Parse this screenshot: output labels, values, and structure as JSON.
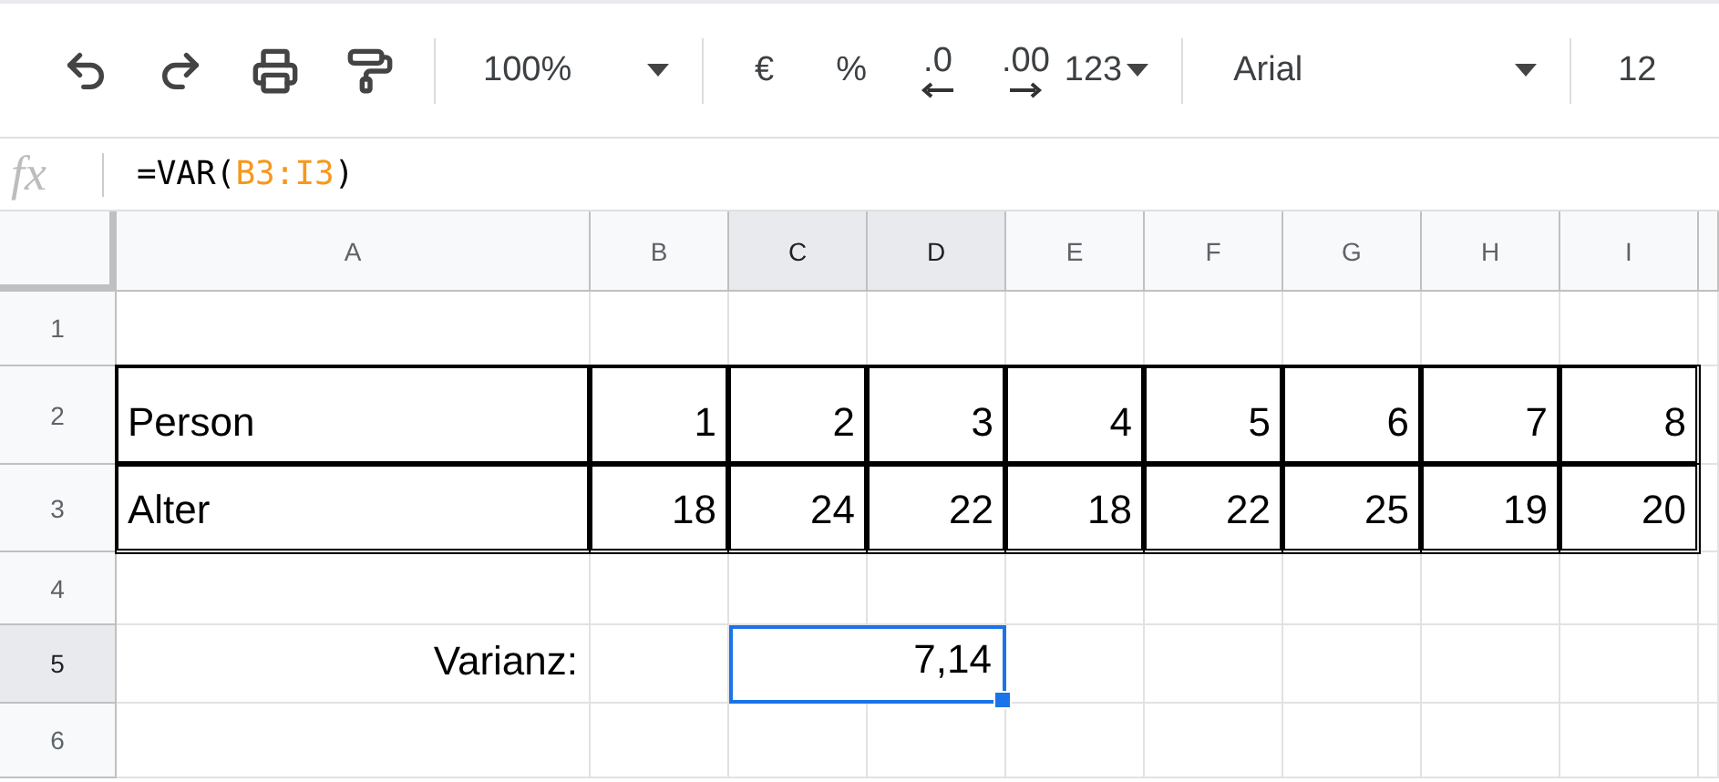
{
  "toolbar": {
    "zoom": "100%",
    "currency": "€",
    "percent": "%",
    "decrease_decimal": ".0",
    "increase_decimal": ".00",
    "more_formats": "123",
    "font": "Arial",
    "font_size": "12"
  },
  "formula_bar": {
    "fx": "fx",
    "formula": [
      {
        "text": "=VAR(",
        "kind": "plain"
      },
      {
        "text": "B3:I3",
        "kind": "reference"
      },
      {
        "text": ")",
        "kind": "plain"
      }
    ]
  },
  "columns": [
    {
      "label": "A",
      "selected": false
    },
    {
      "label": "B",
      "selected": false
    },
    {
      "label": "C",
      "selected": true
    },
    {
      "label": "D",
      "selected": true
    },
    {
      "label": "E",
      "selected": false
    },
    {
      "label": "F",
      "selected": false
    },
    {
      "label": "G",
      "selected": false
    },
    {
      "label": "H",
      "selected": false
    },
    {
      "label": "I",
      "selected": false
    }
  ],
  "rows": [
    {
      "header": "1",
      "selected": false,
      "cells": [
        null,
        null,
        null,
        null,
        null,
        null,
        null,
        null,
        null
      ]
    },
    {
      "header": "2",
      "selected": false,
      "cells": [
        {
          "text": "Person",
          "kind": "text",
          "bordered": true,
          "selected": false
        },
        {
          "text": "1",
          "kind": "number",
          "bordered": true,
          "selected": false
        },
        {
          "text": "2",
          "kind": "number",
          "bordered": true,
          "selected": false
        },
        {
          "text": "3",
          "kind": "number",
          "bordered": true,
          "selected": false
        },
        {
          "text": "4",
          "kind": "number",
          "bordered": true,
          "selected": false
        },
        {
          "text": "5",
          "kind": "number",
          "bordered": true,
          "selected": false
        },
        {
          "text": "6",
          "kind": "number",
          "bordered": true,
          "selected": false
        },
        {
          "text": "7",
          "kind": "number",
          "bordered": true,
          "selected": false
        },
        {
          "text": "8",
          "kind": "number",
          "bordered": true,
          "selected": false
        }
      ]
    },
    {
      "header": "3",
      "selected": false,
      "cells": [
        {
          "text": "Alter",
          "kind": "text",
          "bordered": true,
          "selected": false
        },
        {
          "text": "18",
          "kind": "number",
          "bordered": true,
          "selected": false
        },
        {
          "text": "24",
          "kind": "number",
          "bordered": true,
          "selected": false
        },
        {
          "text": "22",
          "kind": "number",
          "bordered": true,
          "selected": false
        },
        {
          "text": "18",
          "kind": "number",
          "bordered": true,
          "selected": false
        },
        {
          "text": "22",
          "kind": "number",
          "bordered": true,
          "selected": false
        },
        {
          "text": "25",
          "kind": "number",
          "bordered": true,
          "selected": false
        },
        {
          "text": "19",
          "kind": "number",
          "bordered": true,
          "selected": false
        },
        {
          "text": "20",
          "kind": "number",
          "bordered": true,
          "selected": false
        }
      ]
    },
    {
      "header": "4",
      "selected": false,
      "cells": [
        null,
        null,
        null,
        null,
        null,
        null,
        null,
        null,
        null
      ]
    },
    {
      "header": "5",
      "selected": true,
      "cells": [
        {
          "text": "Varianz:",
          "kind": "number",
          "bordered": false,
          "selected": false
        },
        null,
        {
          "text": "7,14",
          "kind": "number",
          "bordered": false,
          "selected": true,
          "merged": true
        },
        null,
        null,
        null,
        null,
        null
      ]
    },
    {
      "header": "6",
      "selected": false,
      "cells": [
        null,
        null,
        null,
        null,
        null,
        null,
        null,
        null,
        null
      ]
    }
  ]
}
